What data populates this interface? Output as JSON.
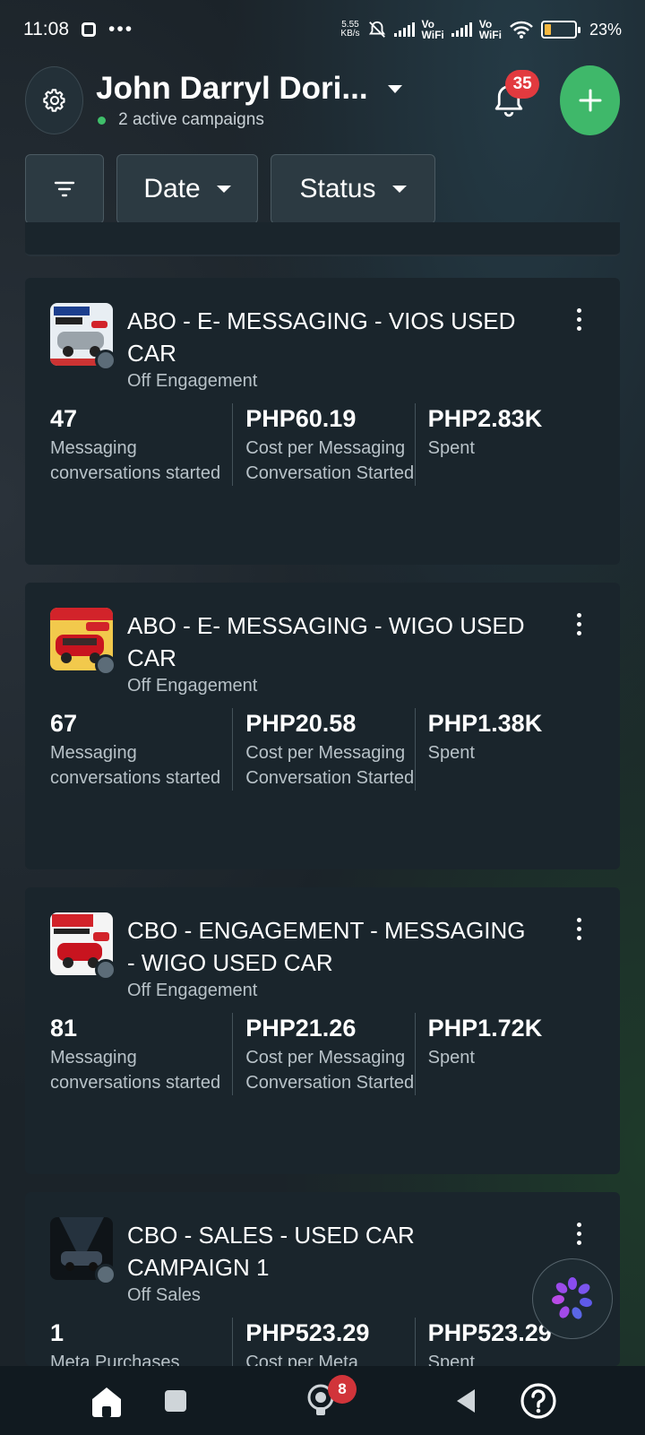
{
  "status_bar": {
    "time": "11:08",
    "net_speed_value": "5.55",
    "net_speed_unit": "KB/s",
    "vo_label": "Vo",
    "wifi_label": "WiFi",
    "battery_percent": "23%",
    "battery_level": 0.23
  },
  "header": {
    "account_name": "John Darryl Dori...",
    "active_campaigns": "2 active campaigns",
    "notification_count": "35"
  },
  "filters": {
    "date_label": "Date",
    "status_label": "Status"
  },
  "campaigns": [
    {
      "title": "ABO - E- MESSAGING - VIOS USED CAR",
      "status": "Off",
      "objective": "Engagement",
      "metrics": [
        {
          "value": "47",
          "label": "Messaging conversations started"
        },
        {
          "value": "PHP60.19",
          "label": "Cost per Messaging Conversation Started"
        },
        {
          "value": "PHP2.83K",
          "label": "Spent"
        }
      ]
    },
    {
      "title": "ABO - E- MESSAGING - WIGO USED CAR",
      "status": "Off",
      "objective": "Engagement",
      "metrics": [
        {
          "value": "67",
          "label": "Messaging conversations started"
        },
        {
          "value": "PHP20.58",
          "label": "Cost per Messaging Conversation Started"
        },
        {
          "value": "PHP1.38K",
          "label": "Spent"
        }
      ]
    },
    {
      "title": "CBO - ENGAGEMENT - MESSAGING  - WIGO USED CAR",
      "status": "Off",
      "objective": "Engagement",
      "metrics": [
        {
          "value": "81",
          "label": "Messaging conversations started"
        },
        {
          "value": "PHP21.26",
          "label": "Cost per Messaging Conversation Started"
        },
        {
          "value": "PHP1.72K",
          "label": "Spent"
        }
      ]
    },
    {
      "title": "CBO - SALES - USED CAR CAMPAIGN 1",
      "status": "Off",
      "objective": "Sales",
      "metrics": [
        {
          "value": "1",
          "label": "Meta Purchases"
        },
        {
          "value": "PHP523.29",
          "label": "Cost per Meta"
        },
        {
          "value": "PHP523.29",
          "label": "Spent"
        }
      ]
    }
  ],
  "bottom_nav": {
    "badge_count": "8"
  },
  "icons": [
    "settings-icon",
    "bell-icon",
    "plus-icon",
    "filter-icon",
    "kebab-icon",
    "meta-ai-icon",
    "home-icon",
    "recents-icon",
    "lightbulb-icon",
    "back-icon",
    "help-icon"
  ],
  "colors": {
    "accent_green": "#3fb86a",
    "badge_red": "#e23a3f",
    "card_bg": "#1a252c"
  }
}
